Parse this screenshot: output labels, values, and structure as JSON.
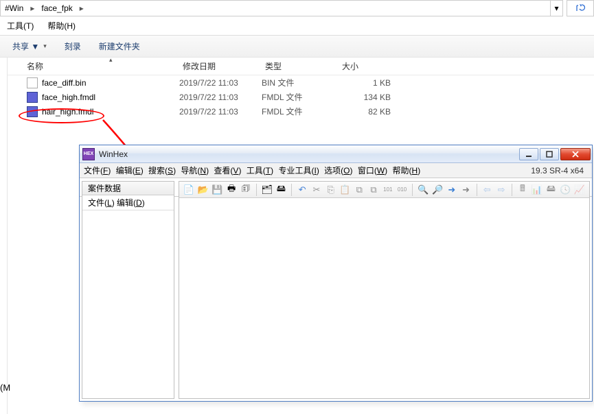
{
  "breadcrumb": {
    "path1": "#Win",
    "path2": "face_fpk"
  },
  "explorer_menu": {
    "tools": "工具(T)",
    "help": "帮助(H)"
  },
  "explorer_toolbar": {
    "share": "共享 ▼",
    "burn": "刻录",
    "new_folder": "新建文件夹"
  },
  "columns": {
    "name": "名称",
    "date": "修改日期",
    "type": "类型",
    "size": "大小"
  },
  "files": [
    {
      "name": "face_diff.bin",
      "date": "2019/7/22 11:03",
      "type": "BIN 文件",
      "size": "1 KB",
      "kind": "bin"
    },
    {
      "name": "face_high.fmdl",
      "date": "2019/7/22 11:03",
      "type": "FMDL 文件",
      "size": "134 KB",
      "kind": "fmdl"
    },
    {
      "name": "hair_high.fmdl",
      "date": "2019/7/22 11:03",
      "type": "FMDL 文件",
      "size": "82 KB",
      "kind": "fmdl"
    }
  ],
  "winhex": {
    "title": "WinHex",
    "menus": [
      "文件(F)",
      "编辑(E)",
      "搜索(S)",
      "导航(N)",
      "查看(V)",
      "工具(T)",
      "专业工具(I)",
      "选项(O)",
      "窗口(W)",
      "帮助(H)"
    ],
    "version": "19.3 SR-4 x64",
    "side_title": "案件数据",
    "side_menus": [
      "文件(L)",
      "编辑(D)"
    ]
  },
  "m_label": "(M"
}
